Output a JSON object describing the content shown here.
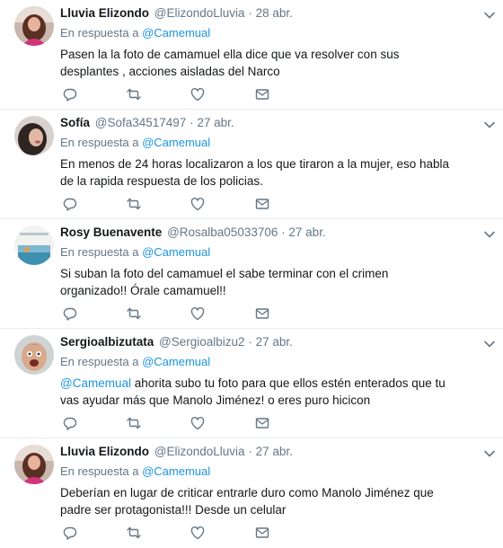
{
  "reply_prefix": "En respuesta a",
  "colors": {
    "link": "#1b95e0",
    "muted": "#657786",
    "text": "#14171a",
    "divider": "#e6ecf0"
  },
  "tweets": [
    {
      "name": "Lluvia Elizondo",
      "handle": "@ElizondoLluvia",
      "separator": "·",
      "time": "28 abr.",
      "reply_to": "@Camemual",
      "mention": "",
      "text": "Pasen la la foto de camamuel ella dice que va resolver con sus desplantes , acciones aisladas del Narco"
    },
    {
      "name": "Sofía",
      "handle": "@Sofa34517497",
      "separator": "·",
      "time": "27 abr.",
      "reply_to": "@Camemual",
      "mention": "",
      "text": "En menos de 24 horas localizaron a los que tiraron a la mujer, eso habla de la rapida respuesta de los policias."
    },
    {
      "name": "Rosy Buenavente",
      "handle": "@Rosalba05033706",
      "separator": "·",
      "time": "27 abr.",
      "reply_to": "@Camemual",
      "mention": "",
      "text": "Si suban la foto del camamuel el sabe terminar con el crimen organizado!! Órale camamuel!!"
    },
    {
      "name": "Sergioalbizutata",
      "handle": "@Sergioalbizu2",
      "separator": "·",
      "time": "27 abr.",
      "reply_to": "@Camemual",
      "mention": "@Camemual",
      "text": " ahorita subo tu foto para que ellos estén enterados que tu vas ayudar más que Manolo Jiménez! o eres puro hicicon"
    },
    {
      "name": "Lluvia Elizondo",
      "handle": "@ElizondoLluvia",
      "separator": "·",
      "time": "27 abr.",
      "reply_to": "@Camemual",
      "mention": "",
      "text": "Deberían en lugar de criticar entrarle duro como Manolo Jiménez que padre ser protagonista!!! Desde un celular"
    }
  ]
}
